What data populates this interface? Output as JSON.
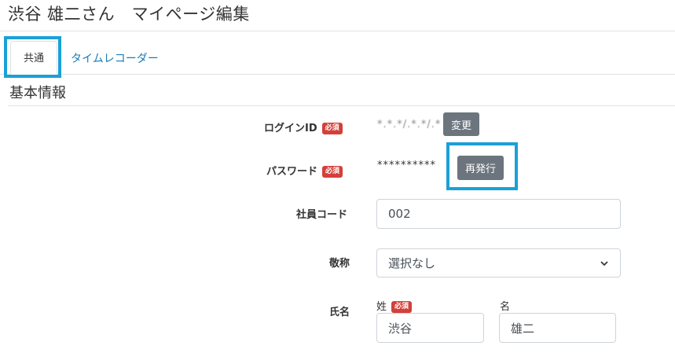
{
  "header": {
    "title": "渋谷 雄二さん　マイページ編集"
  },
  "tabs": [
    {
      "label": "共通",
      "active": true
    },
    {
      "label": "タイムレコーダー",
      "active": false
    }
  ],
  "section": {
    "title": "基本情報"
  },
  "required_badge": "必須",
  "form": {
    "login_id": {
      "label": "ログインID",
      "value": "*.*.*/.*.*/.*",
      "button": "変更"
    },
    "password": {
      "label": "パスワード",
      "value": "**********",
      "button": "再発行"
    },
    "employee_code": {
      "label": "社員コード",
      "value": "002"
    },
    "honorific": {
      "label": "敬称",
      "selected": "選択なし"
    },
    "name": {
      "label": "氏名",
      "last_label": "姓",
      "first_label": "名",
      "last_value": "渋谷",
      "first_value": "雄二"
    }
  },
  "colors": {
    "highlight": "#1aa0d8",
    "link": "#1a7db5",
    "button": "#6c757d",
    "badge": "#d43f3a"
  }
}
